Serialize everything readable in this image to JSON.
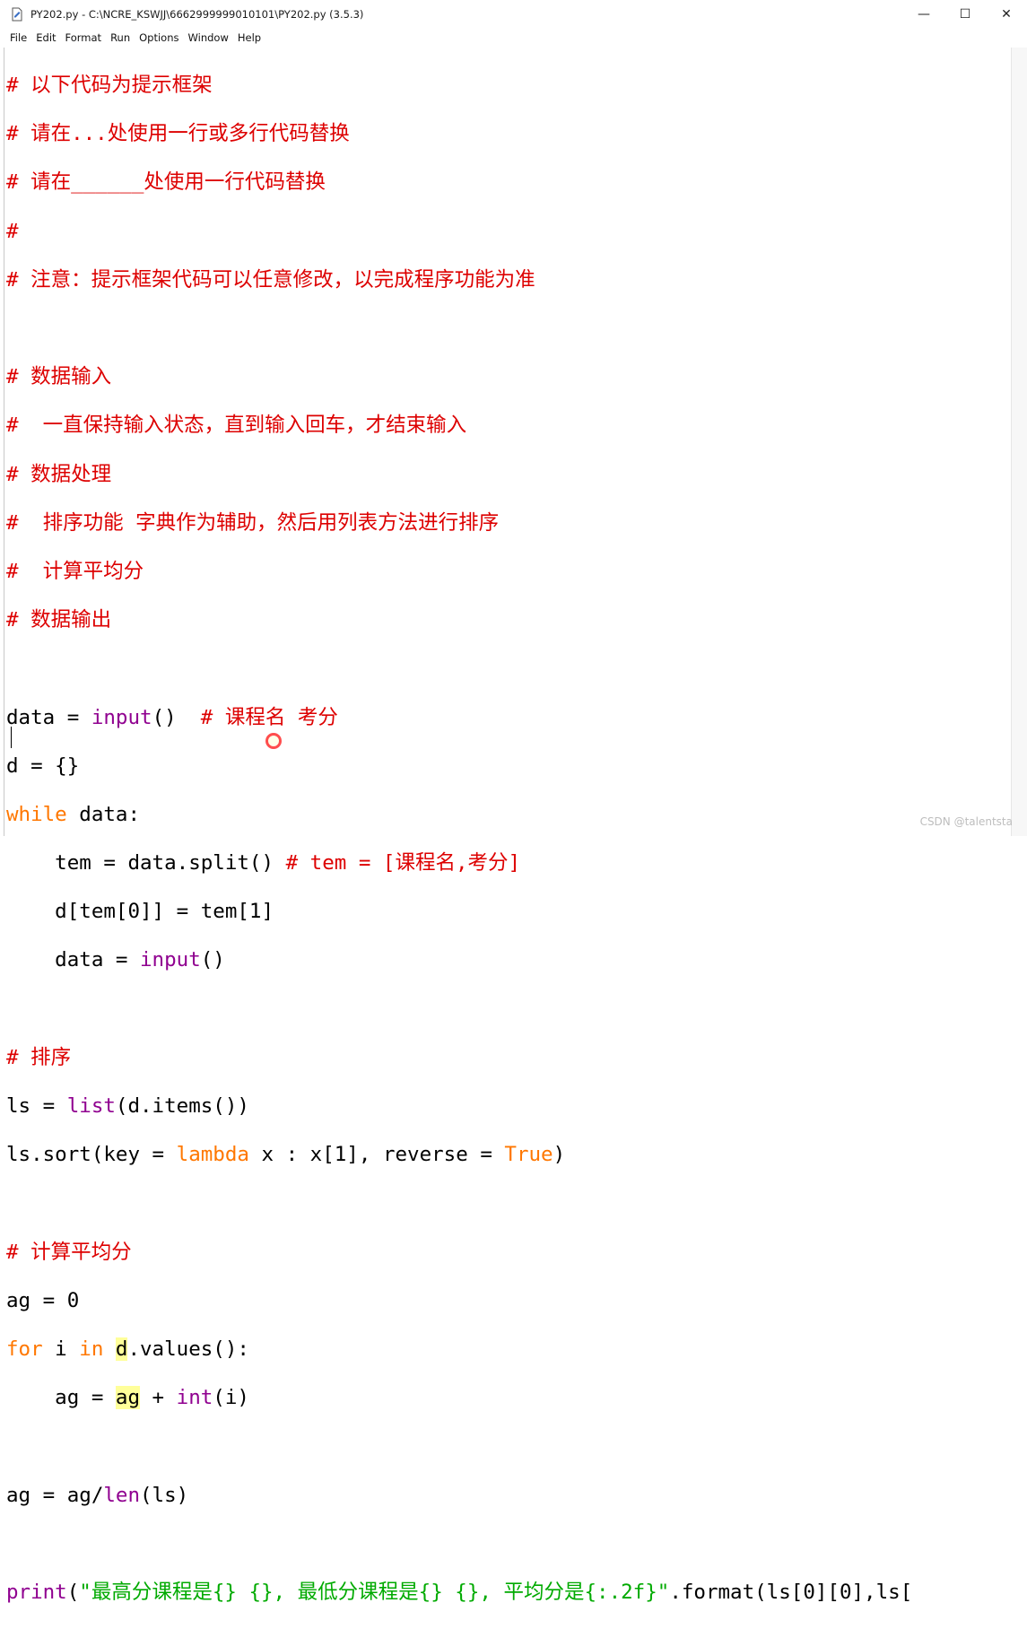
{
  "window": {
    "title": "PY202.py - C:\\NCRE_KSWJJ\\6662999999010101\\PY202.py (3.5.3)",
    "minimize": "—",
    "maximize": "☐",
    "close": "✕"
  },
  "menu": [
    "File",
    "Edit",
    "Format",
    "Run",
    "Options",
    "Window",
    "Help"
  ],
  "code": {
    "l1": "# 以下代码为提示框架",
    "l2": "# 请在...处使用一行或多行代码替换",
    "l3": "# 请在______处使用一行代码替换",
    "l4": "#",
    "l5": "# 注意：提示框架代码可以任意修改，以完成程序功能为准",
    "l7": "# 数据输入",
    "l8": "#  一直保持输入状态，直到输入回车，才结束输入",
    "l9": "# 数据处理",
    "l10": "#  排序功能 字典作为辅助，然后用列表方法进行排序",
    "l11": "#  计算平均分",
    "l12": "# 数据输出",
    "l14_a": "data = ",
    "l14_input": "input",
    "l14_b": "()  ",
    "l14_c": "# 课程名 考分",
    "l15": "d = {}",
    "l16_kw": "while",
    "l16_b": " data:",
    "l17_a": "    tem = data.split() ",
    "l17_c": "# tem = [课程名,考分]",
    "l18": "    d[tem[0]] = tem[1]",
    "l19_a": "    data = ",
    "l19_input": "input",
    "l19_b": "()",
    "l21": "# 排序",
    "l22_a": "ls = ",
    "l22_list": "list",
    "l22_b": "(d.items())",
    "l23_a": "ls.sort(key = ",
    "l23_lambda": "lambda",
    "l23_b": " x : x[1], reverse = ",
    "l23_true": "True",
    "l23_c": ")",
    "l25": "# 计算平均分",
    "l26": "ag = 0",
    "l27_for": "for",
    "l27_a": " i ",
    "l27_in": "in",
    "l27_b": " ",
    "l27_d": "d",
    "l27_c": ".values():",
    "l28_a": "    ag = ",
    "l28_ag": "ag",
    "l28_b": " + ",
    "l28_int": "int",
    "l28_c": "(i)",
    "l30_a": "ag = ag/",
    "l30_len": "len",
    "l30_b": "(ls)",
    "l32_print": "print",
    "l32_a": "(",
    "l32_str": "\"最高分课程是{} {}, 最低分课程是{} {}, 平均分是{:.2f}\"",
    "l32_b": ".format(ls[0][0],ls["
  },
  "watermark": "CSDN @talentsta",
  "colors": {
    "comment": "#dd0000",
    "keyword": "#ff7700",
    "builtin": "#900090",
    "string": "#00aa00"
  }
}
